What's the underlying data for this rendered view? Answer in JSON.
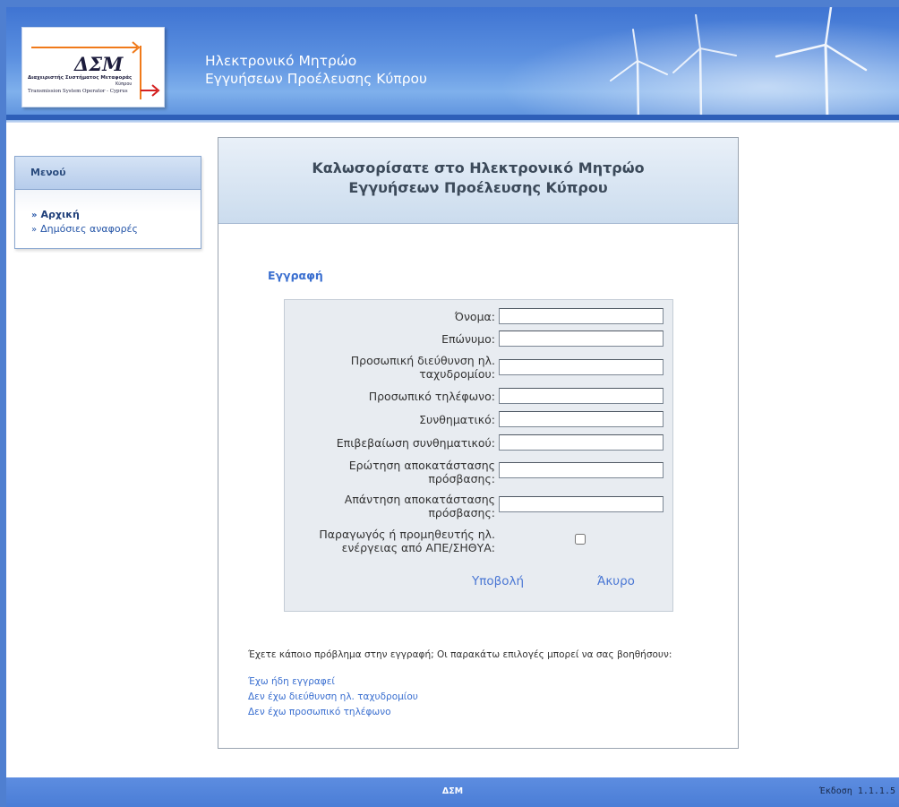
{
  "header": {
    "logo": {
      "brand": "ΔΣΜ",
      "line1": "Διαχειριστής Συστήματος Μεταφοράς",
      "line2": "Κύπρου",
      "line3": "Transmission System Operator - Cyprus"
    },
    "title_line1": "Ηλεκτρονικό Μητρώο",
    "title_line2": "Εγγυήσεων Προέλευσης Κύπρου"
  },
  "sidebar": {
    "heading": "Μενού",
    "items": [
      {
        "label": "Αρχική",
        "active": true
      },
      {
        "label": "Δημόσιες αναφορές",
        "active": false
      }
    ]
  },
  "main": {
    "welcome_line1": "Καλωσορίσατε στο Ηλεκτρονικό Μητρώο",
    "welcome_line2": "Εγγυήσεων Προέλευσης Κύπρου",
    "section_title": "Εγγραφή",
    "form": {
      "first_name": {
        "label": "Όνομα:",
        "value": ""
      },
      "last_name": {
        "label": "Επώνυμο:",
        "value": ""
      },
      "email": {
        "label_line1": "Προσωπική διεύθυνση ηλ.",
        "label_line2": "ταχυδρομίου:",
        "value": ""
      },
      "phone": {
        "label": "Προσωπικό τηλέφωνο:",
        "value": ""
      },
      "password": {
        "label": "Συνθηματικό:",
        "value": ""
      },
      "password_confirm": {
        "label": "Επιβεβαίωση συνθηματικού:",
        "value": ""
      },
      "recovery_question": {
        "label_line1": "Ερώτηση αποκατάστασης",
        "label_line2": "πρόσβασης:",
        "value": ""
      },
      "recovery_answer": {
        "label_line1": "Απάντηση αποκατάστασης",
        "label_line2": "πρόσβασης:",
        "value": ""
      },
      "producer": {
        "label_line1": "Παραγωγός ή προμηθευτής ηλ.",
        "label_line2": "ενέργειας από ΑΠΕ/ΣΗΘΥΑ:",
        "checked": false
      },
      "submit_label": "Υποβολή",
      "cancel_label": "Άκυρο"
    },
    "help": {
      "text": "Έχετε κάποιο πρόβλημα στην εγγραφή; Οι παρακάτω επιλογές μπορεί να σας βοηθήσουν:",
      "links": [
        "Έχω ήδη εγγραφεί",
        "Δεν έχω διεύθυνση ηλ. ταχυδρομίου",
        "Δεν έχω προσωπικό τηλέφωνο"
      ]
    }
  },
  "footer": {
    "name": "ΔΣΜ",
    "version": "Έκδοση 1.1.1.5"
  },
  "colors": {
    "brand_blue": "#4f7fd0",
    "link": "#3a6fd0",
    "logo_orange": "#f07a1a",
    "logo_red": "#d42020"
  }
}
